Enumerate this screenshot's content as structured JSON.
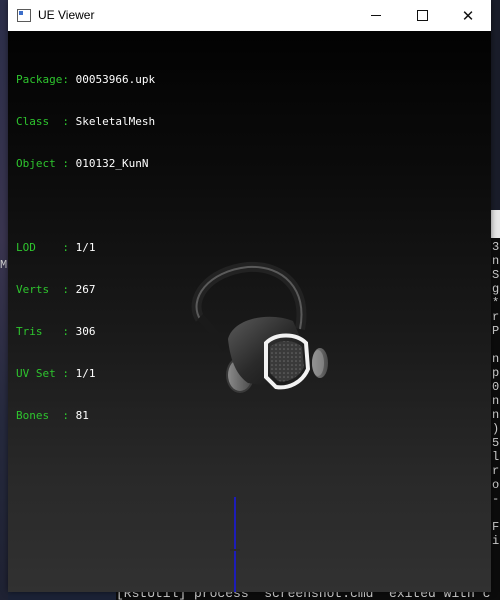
{
  "window": {
    "title": "UE Viewer",
    "controls": {
      "minimize": "minimize",
      "maximize": "maximize",
      "close": "close"
    }
  },
  "info": {
    "package": {
      "label": "Package:",
      "value": "00053966.upk"
    },
    "class": {
      "label": "Class  :",
      "value": "SkeletalMesh"
    },
    "object": {
      "label": "Object :",
      "value": "010132_KunN"
    },
    "lod": {
      "label": "LOD    :",
      "value": "1/1"
    },
    "verts": {
      "label": "Verts  :",
      "value": "267"
    },
    "tris": {
      "label": "Tris   :",
      "value": "306"
    },
    "uvset": {
      "label": "UV Set :",
      "value": "1/1"
    },
    "bones": {
      "label": "Bones  :",
      "value": "81"
    }
  },
  "background": {
    "left_edge_char": "M",
    "terminal_chars": [
      "3",
      "n",
      "S",
      "g",
      "*",
      "r",
      "P",
      "",
      "n",
      "p",
      "0",
      "n",
      "n",
      ")",
      "5",
      "l",
      "r",
      "o",
      "-",
      "",
      "F",
      "i"
    ],
    "terminal_bottom_line": "[RstUtil] process \"screenshot.cmd\" exited with c"
  },
  "colors": {
    "info_label": "#2ec52e",
    "info_value": "#ffffff",
    "axis": "#1d1db8"
  },
  "icons": {
    "app": "app-window-icon",
    "minimize": "minimize-icon",
    "maximize": "maximize-icon",
    "close": "close-icon"
  }
}
